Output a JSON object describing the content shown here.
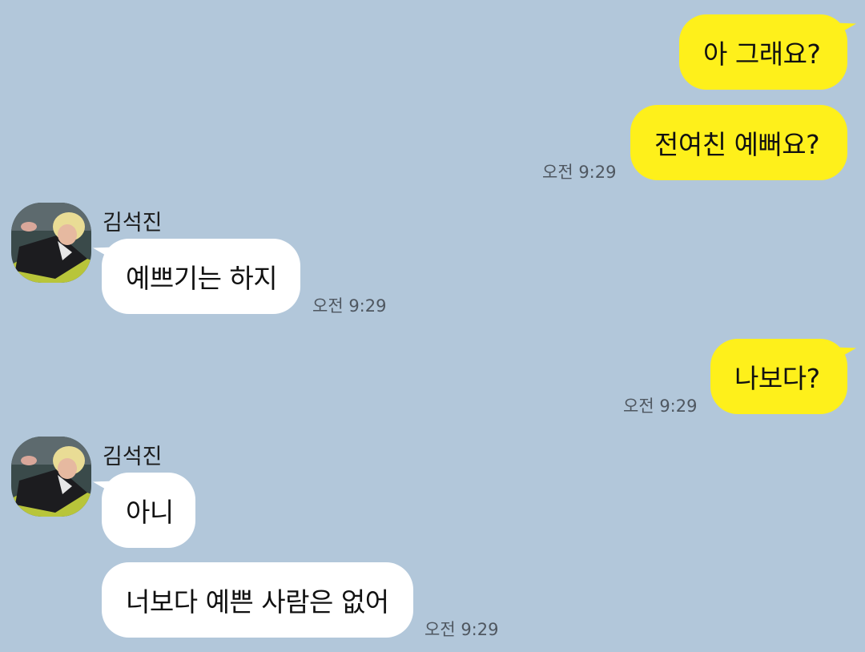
{
  "chat": {
    "messages": [
      {
        "from": "me",
        "text": "아 그래요?"
      },
      {
        "from": "me",
        "text": "전여친 예뻐요?",
        "time": "오전 9:29"
      },
      {
        "from": "them",
        "sender": "김석진",
        "text": "예쁘기는 하지",
        "time": "오전 9:29"
      },
      {
        "from": "me",
        "text": "나보다?",
        "time": "오전 9:29"
      },
      {
        "from": "them",
        "sender": "김석진",
        "text": "아니"
      },
      {
        "from": "them",
        "text": "너보다 예쁜 사람은 없어",
        "time": "오전 9:29"
      }
    ]
  },
  "colors": {
    "background": "#b2c7da",
    "my_bubble": "#fef01b",
    "their_bubble": "#ffffff"
  }
}
